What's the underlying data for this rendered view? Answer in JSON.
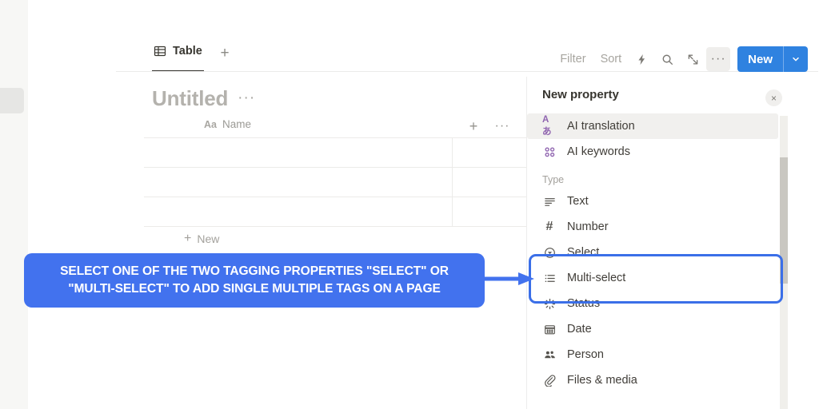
{
  "sidebar": {
    "collapsed_item": ""
  },
  "tabbar": {
    "tab_label": "Table",
    "tab_icon": "table-icon",
    "add_tab_label": "+"
  },
  "database": {
    "title": "Untitled",
    "more_label": "···",
    "column_header": "Name",
    "column_type_glyph": "Aa",
    "add_column_label": "+",
    "column_more_label": "···",
    "new_row_label": "New",
    "new_row_plus": "+",
    "row_count": 3
  },
  "toolbar": {
    "filter_label": "Filter",
    "sort_label": "Sort",
    "automation_icon": "lightning-bolt-icon",
    "search_icon": "search-icon",
    "expand_icon": "expand-arrows-icon",
    "more_label": "···",
    "new_button_label": "New",
    "new_button_caret": "chevron-down-icon",
    "new_button_color": "#2f82e0"
  },
  "panel": {
    "title": "New property",
    "close_label": "×",
    "suggested": [
      {
        "label": "AI translation",
        "icon": "ai-translation-icon",
        "highlighted": true
      },
      {
        "label": "AI keywords",
        "icon": "ai-keywords-icon",
        "highlighted": false
      }
    ],
    "section_label": "Type",
    "types": [
      {
        "label": "Text",
        "icon": "text-lines-icon"
      },
      {
        "label": "Number",
        "icon": "hash-icon"
      },
      {
        "label": "Select",
        "icon": "select-chevron-circle-icon"
      },
      {
        "label": "Multi-select",
        "icon": "multi-select-list-icon"
      },
      {
        "label": "Status",
        "icon": "status-spinner-icon"
      },
      {
        "label": "Date",
        "icon": "calendar-icon"
      },
      {
        "label": "Person",
        "icon": "person-group-icon"
      },
      {
        "label": "Files & media",
        "icon": "paperclip-icon"
      }
    ]
  },
  "annotation": {
    "text": "SELECT ONE OF THE TWO TAGGING PROPERTIES \"SELECT\" OR\n\"MULTI-SELECT\" TO ADD SINGLE MULTIPLE TAGS ON A PAGE",
    "color": "#4272ee",
    "highlight_border_color": "#3b6fe8"
  }
}
